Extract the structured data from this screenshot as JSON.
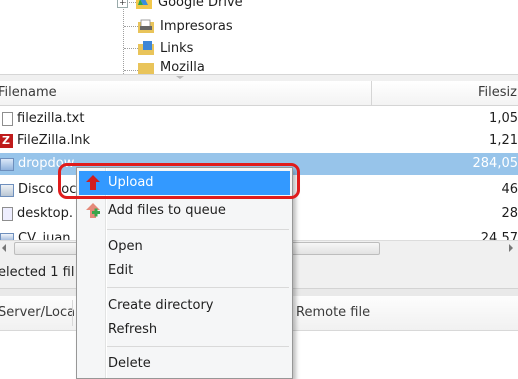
{
  "tree": {
    "items": [
      {
        "label": "Google Drive",
        "icon": "google-drive-icon"
      },
      {
        "label": "Impresoras",
        "icon": "printers-folder-icon"
      },
      {
        "label": "Links",
        "icon": "links-folder-icon"
      },
      {
        "label": "Mozilla",
        "icon": "folder-icon"
      }
    ]
  },
  "file_list": {
    "columns": {
      "filename": "Filename",
      "filesize": "Filesiz"
    },
    "rows": [
      {
        "name": "filezilla.txt",
        "size": "1,05",
        "icon": "text-file-icon",
        "selected": false
      },
      {
        "name": "FileZilla.lnk",
        "size": "1,21",
        "icon": "filezilla-icon",
        "selected": false
      },
      {
        "name": "dropdow",
        "size": "284,05",
        "icon": "image-file-icon",
        "selected": true
      },
      {
        "name": "Disco loc",
        "size": "46",
        "icon": "shortcut-icon",
        "selected": false
      },
      {
        "name": "desktop.",
        "size": "28",
        "icon": "settings-file-icon",
        "selected": false
      },
      {
        "name": "CV_juan",
        "size": "24,57",
        "icon": "document-icon",
        "selected": false
      }
    ]
  },
  "status": {
    "text": "elected 1 fil"
  },
  "queue": {
    "columns": {
      "server": "Server/Loca",
      "remote": "Remote file"
    }
  },
  "context_menu": {
    "items": [
      {
        "label": "Upload",
        "icon": "upload-arrow-icon",
        "highlighted": true
      },
      {
        "label": "Add files to queue",
        "icon": "add-to-queue-icon",
        "highlighted": false
      },
      {
        "label": "Open",
        "highlighted": false
      },
      {
        "label": "Edit",
        "highlighted": false
      },
      {
        "label": "Create directory",
        "highlighted": false
      },
      {
        "label": "Refresh",
        "highlighted": false
      },
      {
        "label": "Delete",
        "highlighted": false
      }
    ]
  },
  "colors": {
    "selection": "#97c4ea",
    "menu_highlight": "#3399ff",
    "callout": "#e01c1c"
  }
}
